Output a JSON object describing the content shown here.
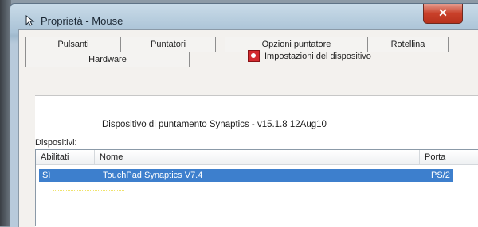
{
  "window": {
    "title": "Proprietà - Mouse",
    "close_label": "✕"
  },
  "tabs": [
    {
      "label": "Pulsanti"
    },
    {
      "label": "Puntatori"
    },
    {
      "label": "Opzioni puntatore"
    },
    {
      "label": "Rotellina"
    },
    {
      "label": "Hardware"
    }
  ],
  "active_tab_index": 5,
  "device_settings_tab": {
    "label": "Impostazioni del dispositivo",
    "icon": "synaptics-icon"
  },
  "driver_info": "Dispositivo di puntamento Synaptics - v15.1.8 12Aug10",
  "devices": {
    "label": "Dispositivi:",
    "columns": [
      "Abilitati",
      "Nome",
      "Porta"
    ],
    "rows": [
      {
        "enabled": "Sì",
        "name": "TouchPad Synaptics V7.4",
        "port": "PS/2",
        "selected": true
      }
    ]
  },
  "colors": {
    "selection": "#3d7fcd",
    "close_button": "#c9402a",
    "device_icon": "#d32a2f"
  }
}
